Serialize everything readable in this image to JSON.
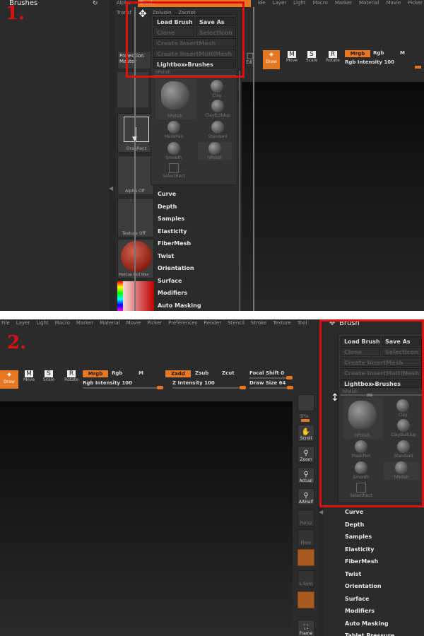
{
  "step1": {
    "label": "1.",
    "top_header_title": "Brushes",
    "menu_partial": [
      "Alpha",
      "Brush",
      "ide",
      "Layer",
      "Light",
      "Macro",
      "Marker",
      "Material",
      "Movie",
      "Picker"
    ],
    "transform_partial": [
      "Transf",
      "Zplugin",
      "Zscript"
    ],
    "projection_master": "Projection\nMaster",
    "lightbox_partial": "LightBox",
    "tools": [
      {
        "label": "Edit"
      },
      {
        "label": "Draw"
      },
      {
        "label": "Move",
        "key": "M"
      },
      {
        "label": "Scale",
        "key": "S"
      },
      {
        "label": "Rotate",
        "key": "R"
      }
    ],
    "mrgb": "Mrgb",
    "rgb": "Rgb",
    "m": "M",
    "rgb_intensity_label": "Rgb Intensity",
    "rgb_intensity_value": "100",
    "left_thumbs": [
      "DragRect",
      "Alpha Off",
      "Texture Off",
      "MatCap Red Wax"
    ],
    "subpalettes": [
      "Curve",
      "Depth",
      "Samples",
      "Elasticity",
      "FiberMesh",
      "Twist",
      "Orientation",
      "Surface",
      "Modifiers",
      "Auto Masking"
    ]
  },
  "brush_panel": {
    "title": "Brush",
    "load_brush": "Load Brush",
    "save_as": "Save As",
    "clone": "Clone",
    "select_icon": "SelectIcon",
    "create_insert_mesh": "Create InsertMesh",
    "create_insert_multimesh": "Create InsertMultiMesh",
    "lightbox_brushes": "Lightbox▸Brushes",
    "current_brush": "hPolish",
    "brushes": [
      "hPolish",
      "Clay",
      "ClayBuildup",
      "MaskPen",
      "Standard",
      "Smooth",
      "hPolish",
      "SelectRect"
    ]
  },
  "step2": {
    "label": "2.",
    "menu": [
      "File",
      "Layer",
      "Light",
      "Macro",
      "Marker",
      "Material",
      "Movie",
      "Picker",
      "Preferences",
      "Render",
      "Stencil",
      "Stroke",
      "Texture",
      "Tool"
    ],
    "brush_header": "Brush",
    "tools": [
      {
        "label": "Draw"
      },
      {
        "label": "Move",
        "key": "M"
      },
      {
        "label": "Scale",
        "key": "S"
      },
      {
        "label": "Rotate",
        "key": "R"
      }
    ],
    "mrgb": "Mrgb",
    "rgb": "Rgb",
    "m": "M",
    "zadd": "Zadd",
    "zsub": "Zsub",
    "zcut": "Zcut",
    "focal_shift_label": "Focal Shift",
    "focal_shift_value": "0",
    "rgb_intensity_label": "Rgb Intensity",
    "rgb_intensity_value": "100",
    "z_intensity_label": "Z Intensity",
    "z_intensity_value": "100",
    "draw_size_label": "Draw Size",
    "draw_size_value": "64",
    "right_tools": [
      "SPix",
      "Scroll",
      "Zoom",
      "Actual",
      "AAHalf",
      "Persp",
      "Floor",
      "L.Sym",
      "Frame"
    ],
    "subpalettes": [
      "Curve",
      "Depth",
      "Samples",
      "Elasticity",
      "FiberMesh",
      "Twist",
      "Orientation",
      "Surface",
      "Modifiers",
      "Auto Masking",
      "Tablet Pressure"
    ]
  },
  "colors": {
    "accent": "#e87722",
    "annotation_red": "#e01010"
  }
}
